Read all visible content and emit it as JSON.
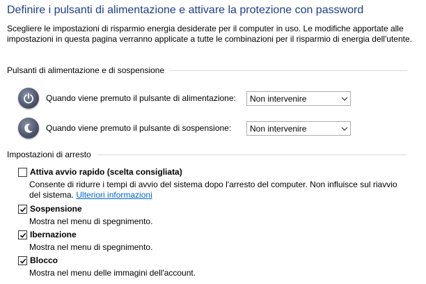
{
  "page": {
    "title": "Definire i pulsanti di alimentazione e attivare la protezione con password",
    "description": "Scegliere le impostazioni di risparmio energia desiderate per il computer in uso. Le modifiche apportate alle impostazioni in questa pagina verranno applicate a tutte le combinazioni per il risparmio di energia dell'utente."
  },
  "power_buttons": {
    "header": "Pulsanti di alimentazione e di sospensione",
    "power": {
      "icon": "power-icon",
      "label": "Quando viene premuto il pulsante di alimentazione:",
      "value": "Non intervenire"
    },
    "sleep": {
      "icon": "sleep-moon-icon",
      "label": "Quando viene premuto il pulsante di sospensione:",
      "value": "Non intervenire"
    }
  },
  "shutdown": {
    "header": "Impostazioni di arresto",
    "items": [
      {
        "label": "Attiva avvio rapido (scelta consigliata)",
        "checked": false,
        "description": "Consente di ridurre i tempi di avvio del sistema dopo l'arresto del computer. Non influisce sul riavvio del sistema.",
        "link": "Ulteriori informazioni"
      },
      {
        "label": "Sospensione",
        "checked": true,
        "description": "Mostra nel menu di spegnimento."
      },
      {
        "label": "Ibernazione",
        "checked": true,
        "description": "Mostra nel menu di spegnimento."
      },
      {
        "label": "Blocco",
        "checked": true,
        "description": "Mostra nel menu delle immagini dell'account."
      }
    ]
  },
  "colors": {
    "title": "#1e3d8c",
    "link": "#0066cc"
  }
}
